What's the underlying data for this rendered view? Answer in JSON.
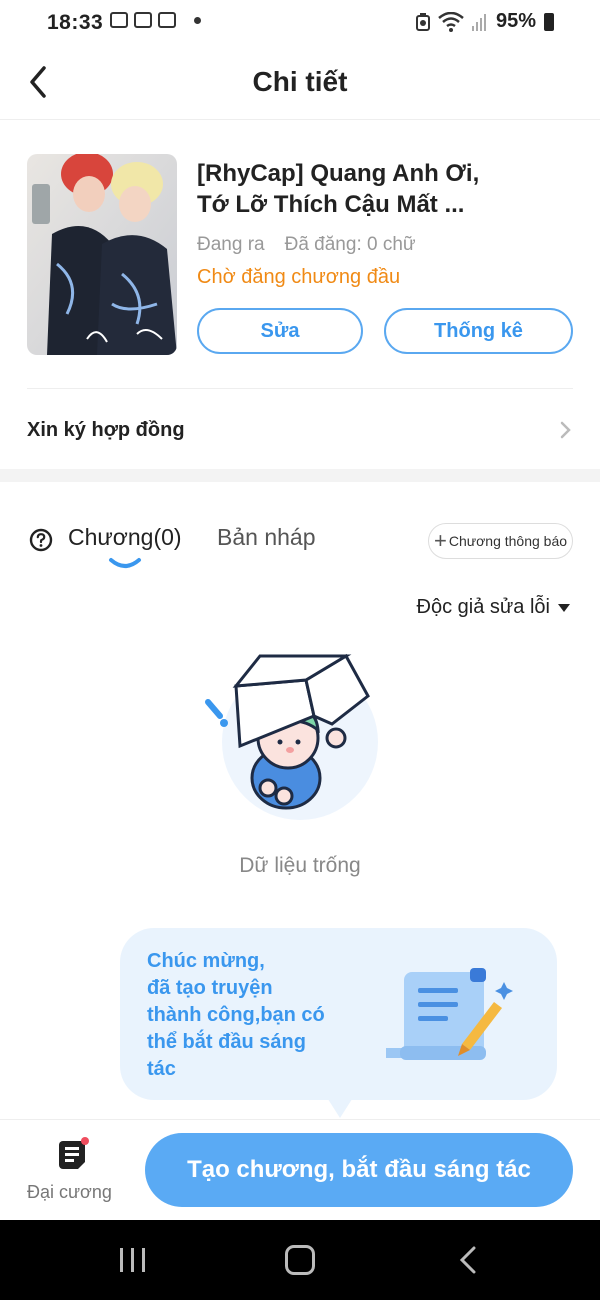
{
  "status_bar": {
    "time": "18:33",
    "battery": "95%"
  },
  "header": {
    "title": "Chi tiết"
  },
  "book": {
    "title_line1": "[RhyCap] Quang Anh Ơi,",
    "title_line2": "Tớ Lỡ Thích Cậu Mất ...",
    "status": "Đang ra",
    "word_count": "Đã đăng: 0 chữ",
    "waiting": "Chờ đăng chương đầu",
    "edit_label": "Sửa",
    "stats_label": "Thống kê"
  },
  "contract": {
    "label": "Xin ký hợp đồng"
  },
  "tabs": {
    "chapters": "Chương(0)",
    "drafts": "Bản nháp",
    "announce": "Chương thông báo"
  },
  "sort": {
    "label": "Độc giả sửa lỗi"
  },
  "empty": {
    "text": "Dữ liệu trống"
  },
  "tooltip": {
    "line1": "Chúc mừng,",
    "line2": "đã tạo truyện",
    "line3": "thành công,bạn có",
    "line4": "thể bắt đầu sáng",
    "line5": "tác"
  },
  "bottom": {
    "outline_label": "Đại cương",
    "create_label": "Tạo chương, bắt đầu sáng tác"
  },
  "colors": {
    "accent": "#3a97ee",
    "orange": "#f08a15",
    "button": "#5aaaf4"
  }
}
